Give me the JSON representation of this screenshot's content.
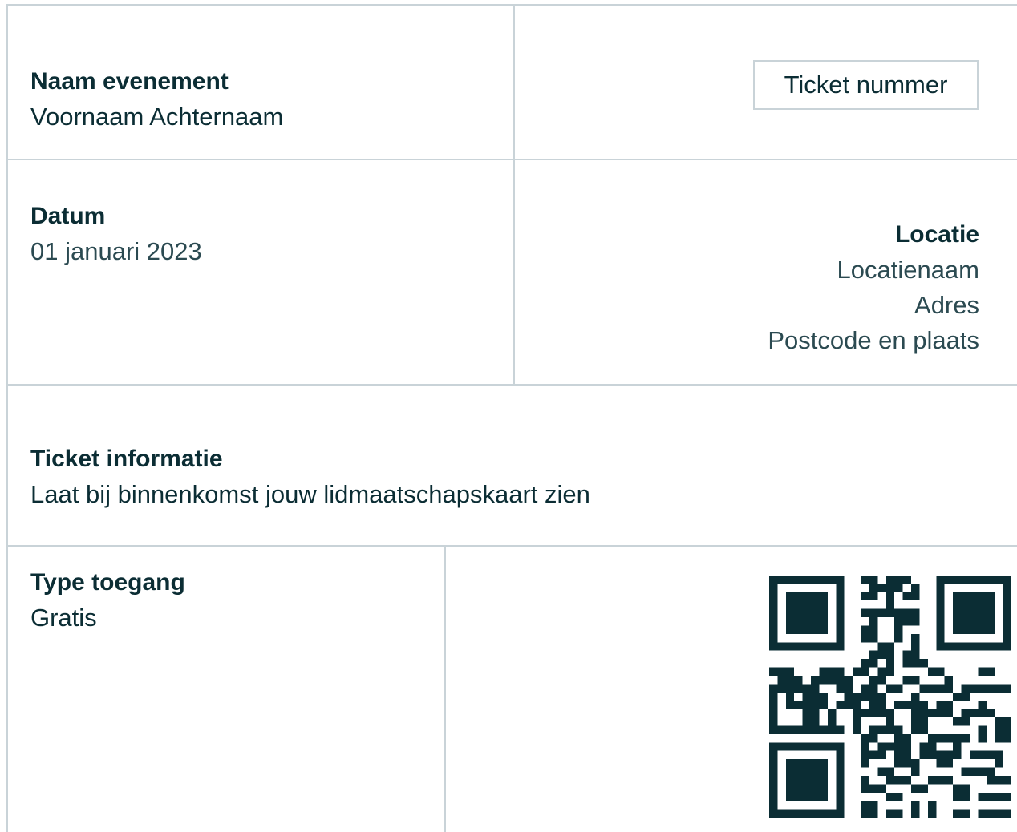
{
  "event": {
    "label": "Naam evenement",
    "attendee": "Voornaam Achternaam"
  },
  "ticket_number": {
    "label": "Ticket nummer"
  },
  "date": {
    "label": "Datum",
    "value": "01 januari 2023"
  },
  "location": {
    "label": "Locatie",
    "name": "Locatienaam",
    "address": "Adres",
    "postal_city": "Postcode en plaats"
  },
  "ticket_info": {
    "label": "Ticket informatie",
    "value": "Laat bij binnenkomst jouw lidmaatschapskaart zien"
  },
  "access_type": {
    "label": "Type toegang",
    "value": "Gratis"
  },
  "colors": {
    "text": "#0b2d34",
    "divider": "#c9d3d8",
    "qr": "#0b2d34"
  }
}
